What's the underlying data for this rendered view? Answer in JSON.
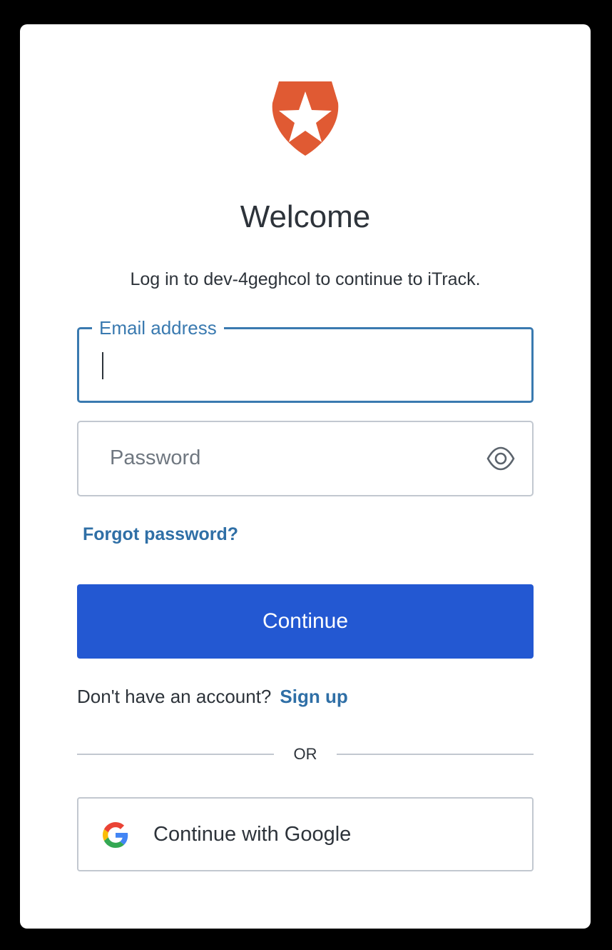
{
  "header": {
    "logo_icon": "auth0-shield-star-icon",
    "brand_color": "#e05a33",
    "title": "Welcome",
    "subtitle": "Log in to dev-4geghcol to continue to iTrack."
  },
  "form": {
    "email": {
      "label": "Email address",
      "value": "",
      "focused": true,
      "border_color": "#3a7ab0"
    },
    "password": {
      "placeholder": "Password",
      "value": "",
      "toggle_icon": "eye-icon"
    },
    "forgot_password_label": "Forgot password?",
    "continue_label": "Continue",
    "continue_color": "#2358d2"
  },
  "signup": {
    "prompt": "Don't have an account?",
    "link_label": "Sign up"
  },
  "divider": {
    "label": "OR"
  },
  "social": {
    "google_label": "Continue with Google",
    "google_icon": "google-g-icon"
  }
}
